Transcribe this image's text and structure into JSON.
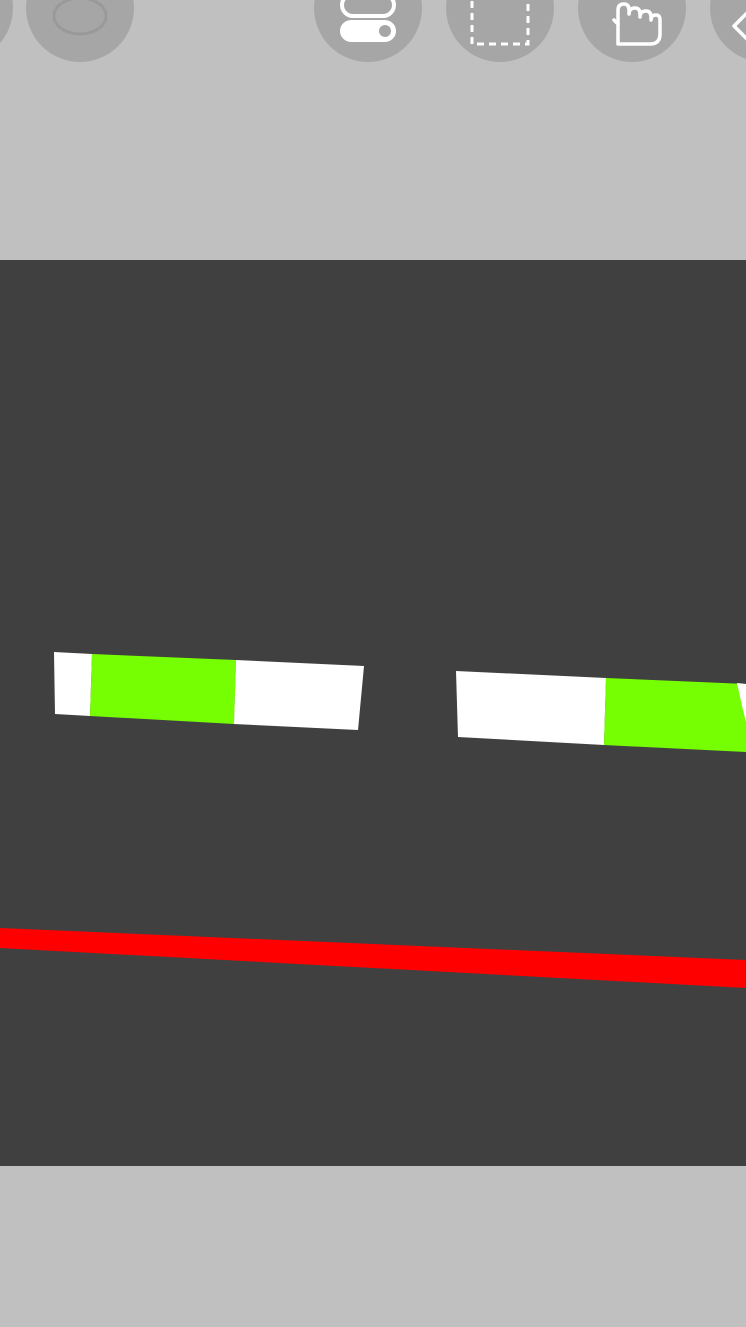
{
  "toolbar": {
    "buttons": [
      {
        "name": "partial-left-tool",
        "icon": "partial-icon"
      },
      {
        "name": "brush-tool",
        "icon": "brush-icon"
      },
      {
        "name": "toggle-tool",
        "icon": "toggle-switch-icon"
      },
      {
        "name": "selection-tool",
        "icon": "dashed-rectangle-icon"
      },
      {
        "name": "hand-tool",
        "icon": "hand-pointer-icon"
      },
      {
        "name": "eraser-tool",
        "icon": "eraser-icon"
      }
    ]
  },
  "canvas": {
    "background": "#404040",
    "colors": {
      "white": "#ffffff",
      "green": "#76ff03",
      "red": "#ff0000"
    }
  },
  "colors": {
    "chrome": "#c0c0c0",
    "button": "#a6a6a6",
    "icon": "#ffffff"
  }
}
